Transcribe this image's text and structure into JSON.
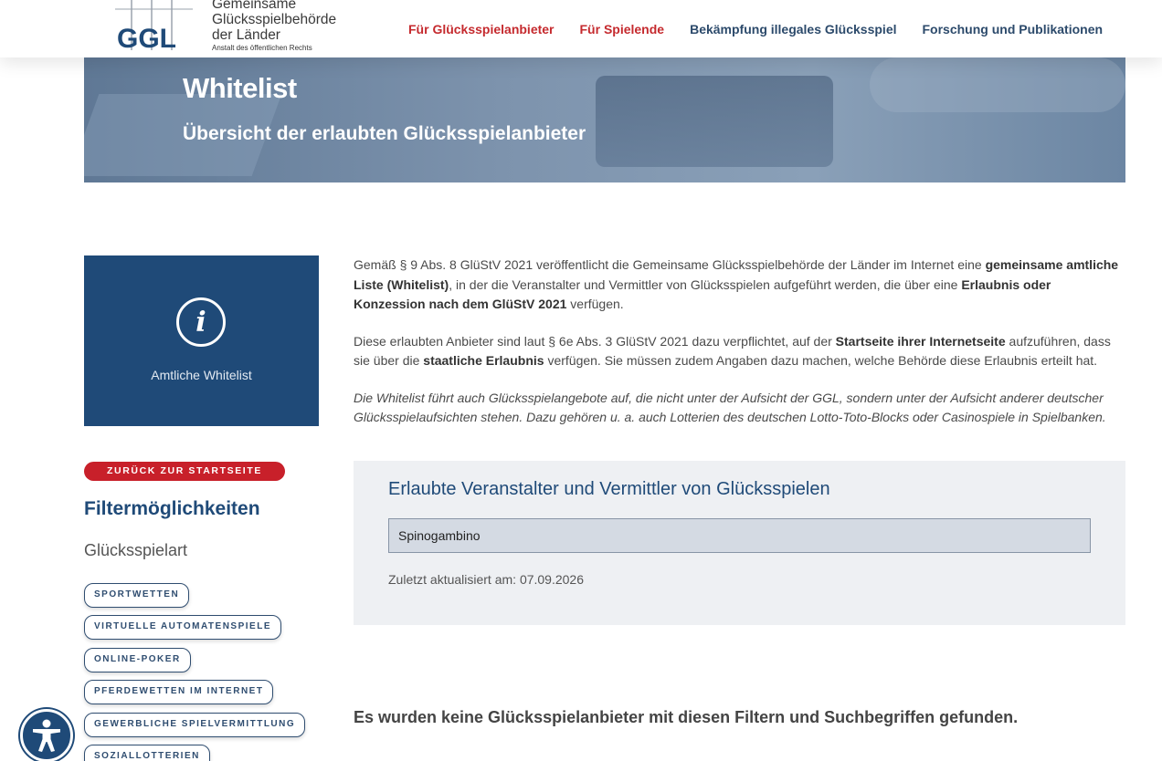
{
  "header": {
    "logo": {
      "mark": "GGL",
      "line1": "Gemeinsame",
      "line2": "Glücksspielbehörde",
      "line3": "der Länder",
      "line4": "Anstalt des öffentlichen Rechts"
    },
    "nav": [
      {
        "label": "Für Glücksspielanbieter",
        "color": "#c52a2e"
      },
      {
        "label": "Für Spielende",
        "color": "#c52a2e"
      },
      {
        "label": "Bekämpfung illegales Glücksspiel",
        "color": "#2c4a6b"
      },
      {
        "label": "Forschung und Publikationen",
        "color": "#2c4a6b"
      }
    ]
  },
  "hero": {
    "title": "Whitelist",
    "subtitle": "Übersicht der erlaubten Glücksspielanbieter"
  },
  "info_tile": {
    "icon": "info-icon",
    "label": "Amtliche Whitelist"
  },
  "intro": {
    "p1_a": "Gemäß § 9 Abs. 8 GlüStV 2021 veröffentlicht die Gemeinsame Glücksspielbehörde der Länder im Internet eine ",
    "p1_b": "gemeinsame amtliche Liste (Whitelist)",
    "p1_c": ", in der die Veranstalter und Vermittler von Glücksspielen aufgeführt werden, die über eine ",
    "p1_d": "Erlaubnis oder Konzession nach dem GlüStV 2021",
    "p1_e": " verfügen.",
    "p2_a": "Diese erlaubten Anbieter sind laut § 6e Abs. 3 GlüStV 2021 dazu verpflichtet, auf der ",
    "p2_b": "Startseite ihrer Internetseite",
    "p2_c": " aufzuführen, dass sie über die ",
    "p2_d": "staatliche Erlaubnis",
    "p2_e": " verfügen. Sie müssen zudem Angaben dazu machen, welche Behörde diese Erlaubnis erteilt hat.",
    "p3": "Die Whitelist führt auch Glücksspielangebote auf, die nicht unter der Aufsicht der GGL, sondern unter der Aufsicht anderer deutscher Glücksspielaufsichten stehen. Dazu gehören u. a. auch Lotterien des deutschen Lotto-Toto-Blocks oder Casinospiele in Spielbanken."
  },
  "sidebar": {
    "back_label": "ZURÜCK ZUR STARTSEITE",
    "filter_title": "Filtermöglichkeiten",
    "filter_sub": "Glücksspielart",
    "chips": [
      "SPORTWETTEN",
      "VIRTUELLE AUTOMATENSPIELE",
      "ONLINE-POKER",
      "PFERDEWETTEN IM INTERNET",
      "GEWERBLICHE SPIELVERMITTLUNG",
      "SOZIALLOTTERIEN"
    ]
  },
  "search_panel": {
    "title": "Erlaubte Veranstalter und Vermittler von Glücksspielen",
    "search_value": "Spinogambino",
    "updated": "Zuletzt aktualisiert am: 07.09.2026"
  },
  "results": {
    "empty_message": "Es wurden keine Glücksspielanbieter mit diesen Filtern und Suchbegriffen gefunden."
  },
  "accessibility": {
    "icon": "accessibility-icon"
  }
}
